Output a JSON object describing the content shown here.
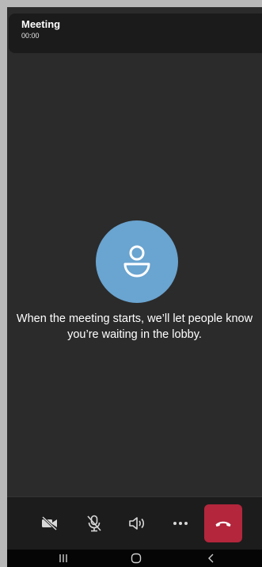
{
  "header": {
    "title": "Meeting",
    "timer": "00:00"
  },
  "lobby": {
    "avatar_icon": "person-icon",
    "message": "When the meeting starts, we’ll let people know you’re waiting in the lobby."
  },
  "controls": [
    {
      "name": "camera-off-button",
      "icon": "camera-off-icon"
    },
    {
      "name": "mic-off-button",
      "icon": "mic-off-icon"
    },
    {
      "name": "speaker-button",
      "icon": "speaker-icon"
    },
    {
      "name": "more-options-button",
      "icon": "more-icon"
    },
    {
      "name": "hang-up-button",
      "icon": "phone-hangup-icon"
    }
  ],
  "system_nav": [
    {
      "name": "recent-apps-button",
      "icon": "recent-apps-icon"
    },
    {
      "name": "home-button",
      "icon": "home-icon"
    },
    {
      "name": "back-button",
      "icon": "back-icon"
    }
  ],
  "colors": {
    "background": "#2b2b2b",
    "avatar": "#6aa4d0",
    "hangup": "#b3263c",
    "control_bar": "#1c1c1c"
  }
}
